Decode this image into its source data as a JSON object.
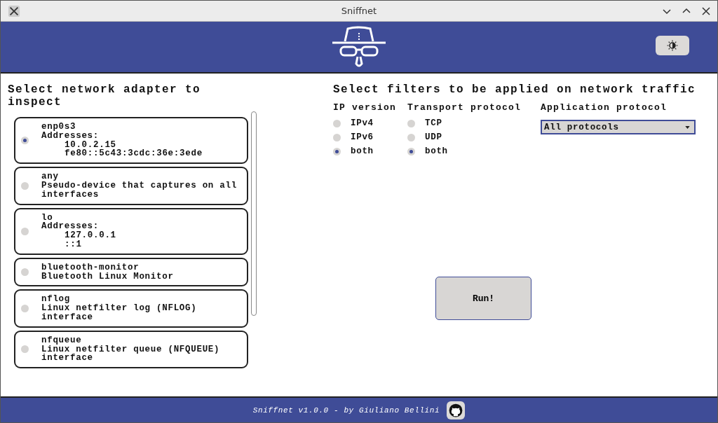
{
  "window": {
    "title": "Sniffnet"
  },
  "adapters": {
    "title": "Select network adapter to inspect",
    "items": [
      {
        "name": "enp0s3",
        "description": "Addresses:",
        "addresses": [
          "10.0.2.15",
          "fe80::5c43:3cdc:36e:3ede"
        ],
        "selected": true
      },
      {
        "name": "any",
        "description": "Pseudo-device that captures on all interfaces",
        "selected": false
      },
      {
        "name": "lo",
        "description": "Addresses:",
        "addresses": [
          "127.0.0.1",
          "::1"
        ],
        "selected": false
      },
      {
        "name": "bluetooth-monitor",
        "description": "Bluetooth Linux Monitor",
        "selected": false
      },
      {
        "name": "nflog",
        "description": "Linux netfilter log (NFLOG) interface",
        "selected": false
      },
      {
        "name": "nfqueue",
        "description": "Linux netfilter queue (NFQUEUE) interface",
        "selected": false
      }
    ]
  },
  "filters": {
    "title": "Select filters to be applied on network traffic",
    "ip_version": {
      "label": "IP version",
      "options": [
        {
          "label": "IPv4",
          "selected": false
        },
        {
          "label": "IPv6",
          "selected": false
        },
        {
          "label": "both",
          "selected": true
        }
      ]
    },
    "transport": {
      "label": "Transport protocol",
      "options": [
        {
          "label": "TCP",
          "selected": false
        },
        {
          "label": "UDP",
          "selected": false
        },
        {
          "label": "both",
          "selected": true
        }
      ]
    },
    "application": {
      "label": "Application protocol",
      "value": "All protocols"
    }
  },
  "run_button": "Run!",
  "footer": "Sniffnet v1.0.0 - by Giuliano Bellini"
}
